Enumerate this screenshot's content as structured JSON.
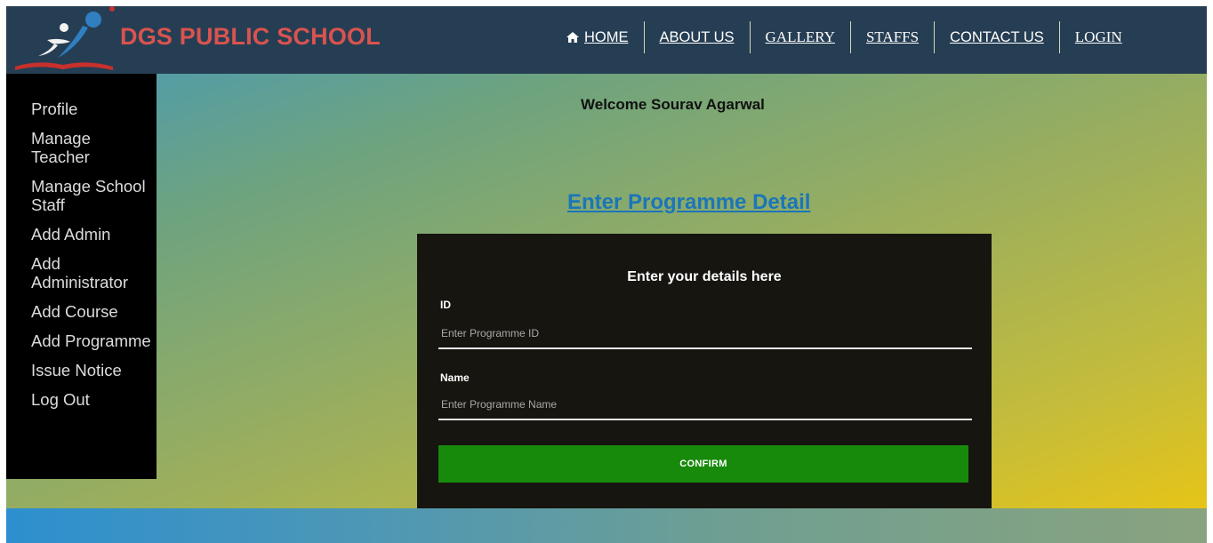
{
  "header": {
    "brand": "DGS PUBLIC SCHOOL",
    "nav": [
      {
        "label": "HOME",
        "icon": "home-icon"
      },
      {
        "label": "ABOUT US"
      },
      {
        "label": "GALLERY"
      },
      {
        "label": "STAFFS"
      },
      {
        "label": "CONTACT US"
      },
      {
        "label": "LOGIN"
      }
    ]
  },
  "sidebar": {
    "items": [
      {
        "label": "Profile"
      },
      {
        "label": "Manage Teacher"
      },
      {
        "label": "Manage School Staff"
      },
      {
        "label": "Add Admin"
      },
      {
        "label": "Add Administrator"
      },
      {
        "label": "Add Course"
      },
      {
        "label": "Add Programme"
      },
      {
        "label": "Issue Notice"
      },
      {
        "label": "Log Out"
      }
    ]
  },
  "main": {
    "welcome": "Welcome Sourav Agarwal",
    "heading": "Enter Programme Detail"
  },
  "form": {
    "title": "Enter your details here",
    "id_label": "ID",
    "id_placeholder": "Enter Programme ID",
    "name_label": "Name",
    "name_placeholder": "Enter Programme Name",
    "confirm_label": "CONFIRM"
  },
  "colors": {
    "header_bg": "#263e53",
    "brand": "#d9534f",
    "heading": "#1b75b9",
    "panel_bg": "#161510",
    "confirm_bg": "#178a0b"
  }
}
